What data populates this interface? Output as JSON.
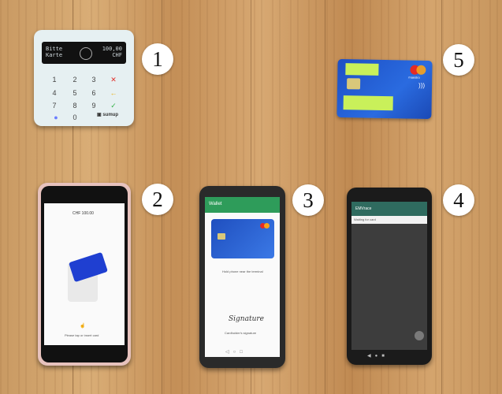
{
  "labels": [
    "1",
    "2",
    "3",
    "4",
    "5"
  ],
  "terminal": {
    "display_left": "Bitte\nKarte",
    "display_right": "100,00\nCHF",
    "keys": [
      "1",
      "2",
      "3",
      "4",
      "5",
      "6",
      "7",
      "8",
      "9",
      "0"
    ],
    "brand": "sumup"
  },
  "card": {
    "brand": "maestro"
  },
  "phone2": {
    "amount": "CHF 100.00",
    "prompt": "Please tap or insert card"
  },
  "phone3": {
    "app_title": "Wallet",
    "hint": "Hold phone near the terminal",
    "signature": "Signature",
    "caption": "Cardholder's signature"
  },
  "phone4": {
    "app_title": "EMVrace",
    "status": "Waiting for card"
  },
  "colors": {
    "wood": "#c99a63",
    "card_blue": "#2a6be0",
    "sticker_green": "#c9f05a",
    "wallet_green": "#2e9c5a",
    "emv_teal": "#2f6b5f",
    "phone2_case": "#e7c2bd"
  }
}
